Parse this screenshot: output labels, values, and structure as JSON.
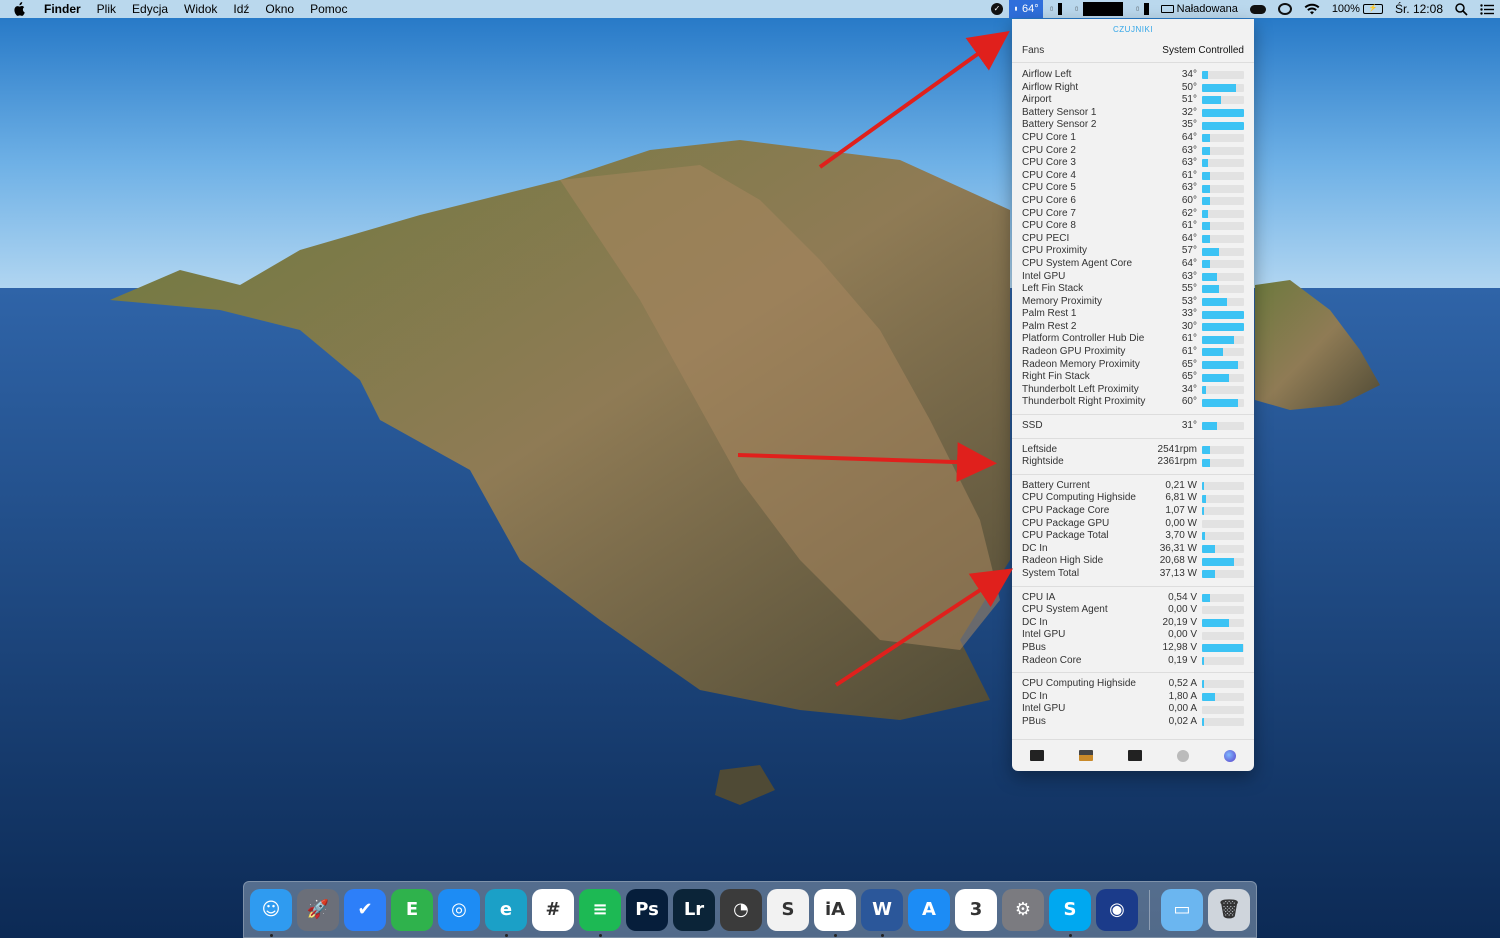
{
  "menubar": {
    "app_name": "Finder",
    "items": [
      "Plik",
      "Edycja",
      "Widok",
      "Idź",
      "Okno",
      "Pomoc"
    ],
    "temp_indicator": "64°",
    "battery_label": "Naładowana",
    "battery_percent": "100%",
    "clock": "Śr. 12:08"
  },
  "panel": {
    "title": "CZUJNIKI",
    "fans_label": "Fans",
    "fans_mode": "System Controlled",
    "temperatures": [
      {
        "label": "Airflow Left",
        "value": "34°",
        "level": 0.15
      },
      {
        "label": "Airflow Right",
        "value": "50°",
        "level": 0.8
      },
      {
        "label": "Airport",
        "value": "51°",
        "level": 0.45
      },
      {
        "label": "Battery Sensor 1",
        "value": "32°",
        "level": 1.0
      },
      {
        "label": "Battery Sensor 2",
        "value": "35°",
        "level": 1.0
      },
      {
        "label": "CPU Core 1",
        "value": "64°",
        "level": 0.2
      },
      {
        "label": "CPU Core 2",
        "value": "63°",
        "level": 0.2
      },
      {
        "label": "CPU Core 3",
        "value": "63°",
        "level": 0.15
      },
      {
        "label": "CPU Core 4",
        "value": "61°",
        "level": 0.2
      },
      {
        "label": "CPU Core 5",
        "value": "63°",
        "level": 0.2
      },
      {
        "label": "CPU Core 6",
        "value": "60°",
        "level": 0.2
      },
      {
        "label": "CPU Core 7",
        "value": "62°",
        "level": 0.15
      },
      {
        "label": "CPU Core 8",
        "value": "61°",
        "level": 0.2
      },
      {
        "label": "CPU PECI",
        "value": "64°",
        "level": 0.2
      },
      {
        "label": "CPU Proximity",
        "value": "57°",
        "level": 0.4
      },
      {
        "label": "CPU System Agent Core",
        "value": "64°",
        "level": 0.2
      },
      {
        "label": "Intel GPU",
        "value": "63°",
        "level": 0.35
      },
      {
        "label": "Left Fin Stack",
        "value": "55°",
        "level": 0.4
      },
      {
        "label": "Memory Proximity",
        "value": "53°",
        "level": 0.6
      },
      {
        "label": "Palm Rest 1",
        "value": "33°",
        "level": 1.0
      },
      {
        "label": "Palm Rest 2",
        "value": "30°",
        "level": 1.0
      },
      {
        "label": "Platform Controller Hub Die",
        "value": "61°",
        "level": 0.75
      },
      {
        "label": "Radeon GPU Proximity",
        "value": "61°",
        "level": 0.5
      },
      {
        "label": "Radeon Memory Proximity",
        "value": "65°",
        "level": 0.85
      },
      {
        "label": "Right Fin Stack",
        "value": "65°",
        "level": 0.65
      },
      {
        "label": "Thunderbolt Left Proximity",
        "value": "34°",
        "level": 0.1
      },
      {
        "label": "Thunderbolt Right Proximity",
        "value": "60°",
        "level": 0.85
      }
    ],
    "ssd": [
      {
        "label": "SSD",
        "value": "31°",
        "level": 0.35
      }
    ],
    "fans": [
      {
        "label": "Leftside",
        "value": "2541rpm",
        "level": 0.2
      },
      {
        "label": "Rightside",
        "value": "2361rpm",
        "level": 0.2
      }
    ],
    "power": [
      {
        "label": "Battery Current",
        "value": "0,21 W",
        "level": 0.02
      },
      {
        "label": "CPU Computing Highside",
        "value": "6,81 W",
        "level": 0.1
      },
      {
        "label": "CPU Package Core",
        "value": "1,07 W",
        "level": 0.03
      },
      {
        "label": "CPU Package GPU",
        "value": "0,00 W",
        "level": 0.0
      },
      {
        "label": "CPU Package Total",
        "value": "3,70 W",
        "level": 0.06
      },
      {
        "label": "DC In",
        "value": "36,31 W",
        "level": 0.3
      },
      {
        "label": "Radeon High Side",
        "value": "20,68 W",
        "level": 0.75
      },
      {
        "label": "System Total",
        "value": "37,13 W",
        "level": 0.3
      }
    ],
    "voltage": [
      {
        "label": "CPU IA",
        "value": "0,54 V",
        "level": 0.2
      },
      {
        "label": "CPU System Agent",
        "value": "0,00 V",
        "level": 0.0
      },
      {
        "label": "DC In",
        "value": "20,19 V",
        "level": 0.65
      },
      {
        "label": "Intel GPU",
        "value": "0,00 V",
        "level": 0.0
      },
      {
        "label": "PBus",
        "value": "12,98 V",
        "level": 0.98
      },
      {
        "label": "Radeon Core",
        "value": "0,19 V",
        "level": 0.04
      }
    ],
    "current": [
      {
        "label": "CPU Computing Highside",
        "value": "0,52 A",
        "level": 0.05
      },
      {
        "label": "DC In",
        "value": "1,80 A",
        "level": 0.3
      },
      {
        "label": "Intel GPU",
        "value": "0,00 A",
        "level": 0.0
      },
      {
        "label": "PBus",
        "value": "0,02 A",
        "level": 0.02
      }
    ],
    "footer_icons": [
      "monitor-icon",
      "lcd-display-icon",
      "terminal-icon",
      "fan-icon",
      "globe-icon"
    ]
  },
  "dock": {
    "apps": [
      {
        "name": "finder",
        "glyph": "☺",
        "color": "#2f9bf0"
      },
      {
        "name": "launchpad",
        "glyph": "🚀",
        "color": "#6b6f79"
      },
      {
        "name": "things",
        "glyph": "✔",
        "color": "#2d7ff9"
      },
      {
        "name": "evernote",
        "glyph": "E",
        "color": "#2fb24c"
      },
      {
        "name": "safari",
        "glyph": "◎",
        "color": "#1d8cf4"
      },
      {
        "name": "edge",
        "glyph": "e",
        "color": "#1ba0c7"
      },
      {
        "name": "slack",
        "glyph": "#",
        "color": "#ffffff"
      },
      {
        "name": "spotify",
        "glyph": "≡",
        "color": "#1db954"
      },
      {
        "name": "photoshop",
        "glyph": "Ps",
        "color": "#061e3b"
      },
      {
        "name": "lightroom",
        "glyph": "Lr",
        "color": "#0b2438"
      },
      {
        "name": "daisydisk",
        "glyph": "◔",
        "color": "#3b3b3b"
      },
      {
        "name": "scrivener",
        "glyph": "S",
        "color": "#f2f2f2"
      },
      {
        "name": "ia-writer",
        "glyph": "iA",
        "color": "#ffffff"
      },
      {
        "name": "word",
        "glyph": "W",
        "color": "#2b579a"
      },
      {
        "name": "app-store",
        "glyph": "A",
        "color": "#1c8cf5"
      },
      {
        "name": "calendar",
        "glyph": "3",
        "color": "#ffffff"
      },
      {
        "name": "system-preferences",
        "glyph": "⚙",
        "color": "#7b7b80"
      },
      {
        "name": "skype",
        "glyph": "S",
        "color": "#00a8f0"
      },
      {
        "name": "istat-menus",
        "glyph": "◉",
        "color": "#1b3b8a"
      },
      {
        "name": "downloads-folder",
        "glyph": "▭",
        "color": "#6bb6f0"
      },
      {
        "name": "trash",
        "glyph": "🗑",
        "color": "#cfd5dc"
      }
    ]
  }
}
